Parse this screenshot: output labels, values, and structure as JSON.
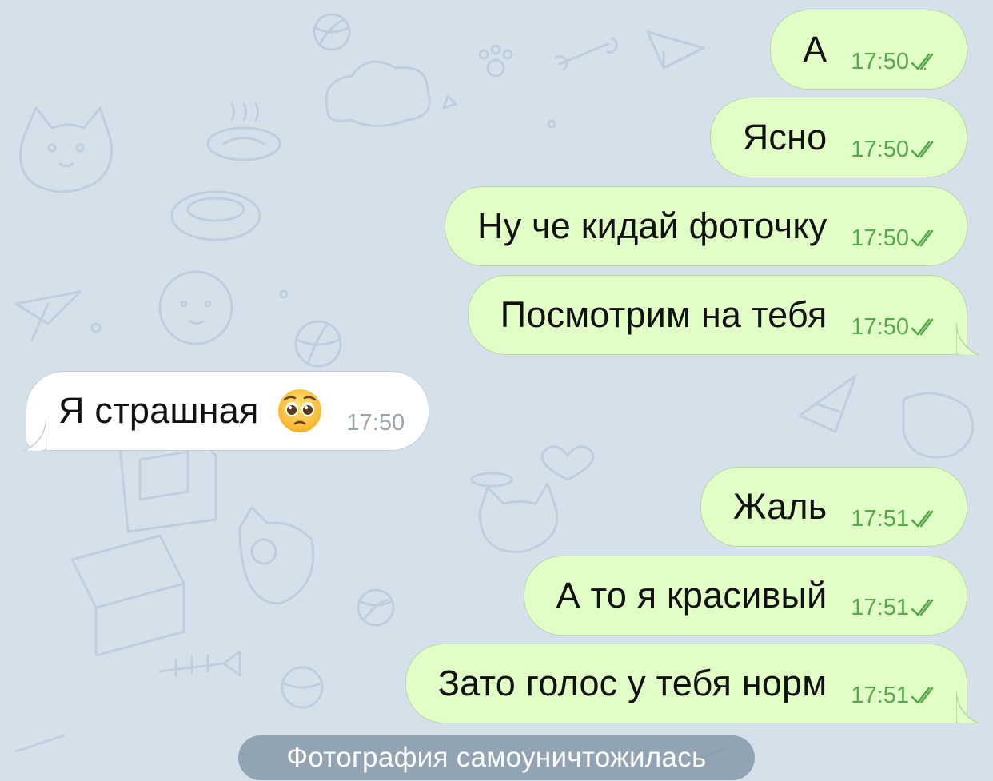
{
  "theme": {
    "background": "#d5e1ea",
    "outgoing_bubble": "#e1fec6",
    "incoming_bubble": "#ffffff",
    "outgoing_time": "#56a84c",
    "incoming_time": "#9aa4ad"
  },
  "messages": [
    {
      "direction": "outgoing",
      "text": "А",
      "time": "17:50",
      "status": "read",
      "status_icon": "double-check-icon"
    },
    {
      "direction": "outgoing",
      "text": "Ясно",
      "time": "17:50",
      "status": "read",
      "status_icon": "double-check-icon"
    },
    {
      "direction": "outgoing",
      "text": "Ну че кидай фоточку",
      "time": "17:50",
      "status": "read",
      "status_icon": "double-check-icon"
    },
    {
      "direction": "outgoing",
      "text": "Посмотрим на тебя",
      "time": "17:50",
      "status": "read",
      "status_icon": "double-check-icon"
    },
    {
      "direction": "incoming",
      "text": "Я страшная",
      "emoji": "pleading-face-emoji",
      "time": "17:50"
    },
    {
      "direction": "outgoing",
      "text": "Жаль",
      "time": "17:51",
      "status": "read",
      "status_icon": "double-check-icon"
    },
    {
      "direction": "outgoing",
      "text": "А то я красивый",
      "time": "17:51",
      "status": "read",
      "status_icon": "double-check-icon"
    },
    {
      "direction": "outgoing",
      "text": "Зато голос у тебя норм",
      "time": "17:51",
      "status": "read",
      "status_icon": "double-check-icon"
    }
  ],
  "service_message": "Фотография самоуничтожилась"
}
